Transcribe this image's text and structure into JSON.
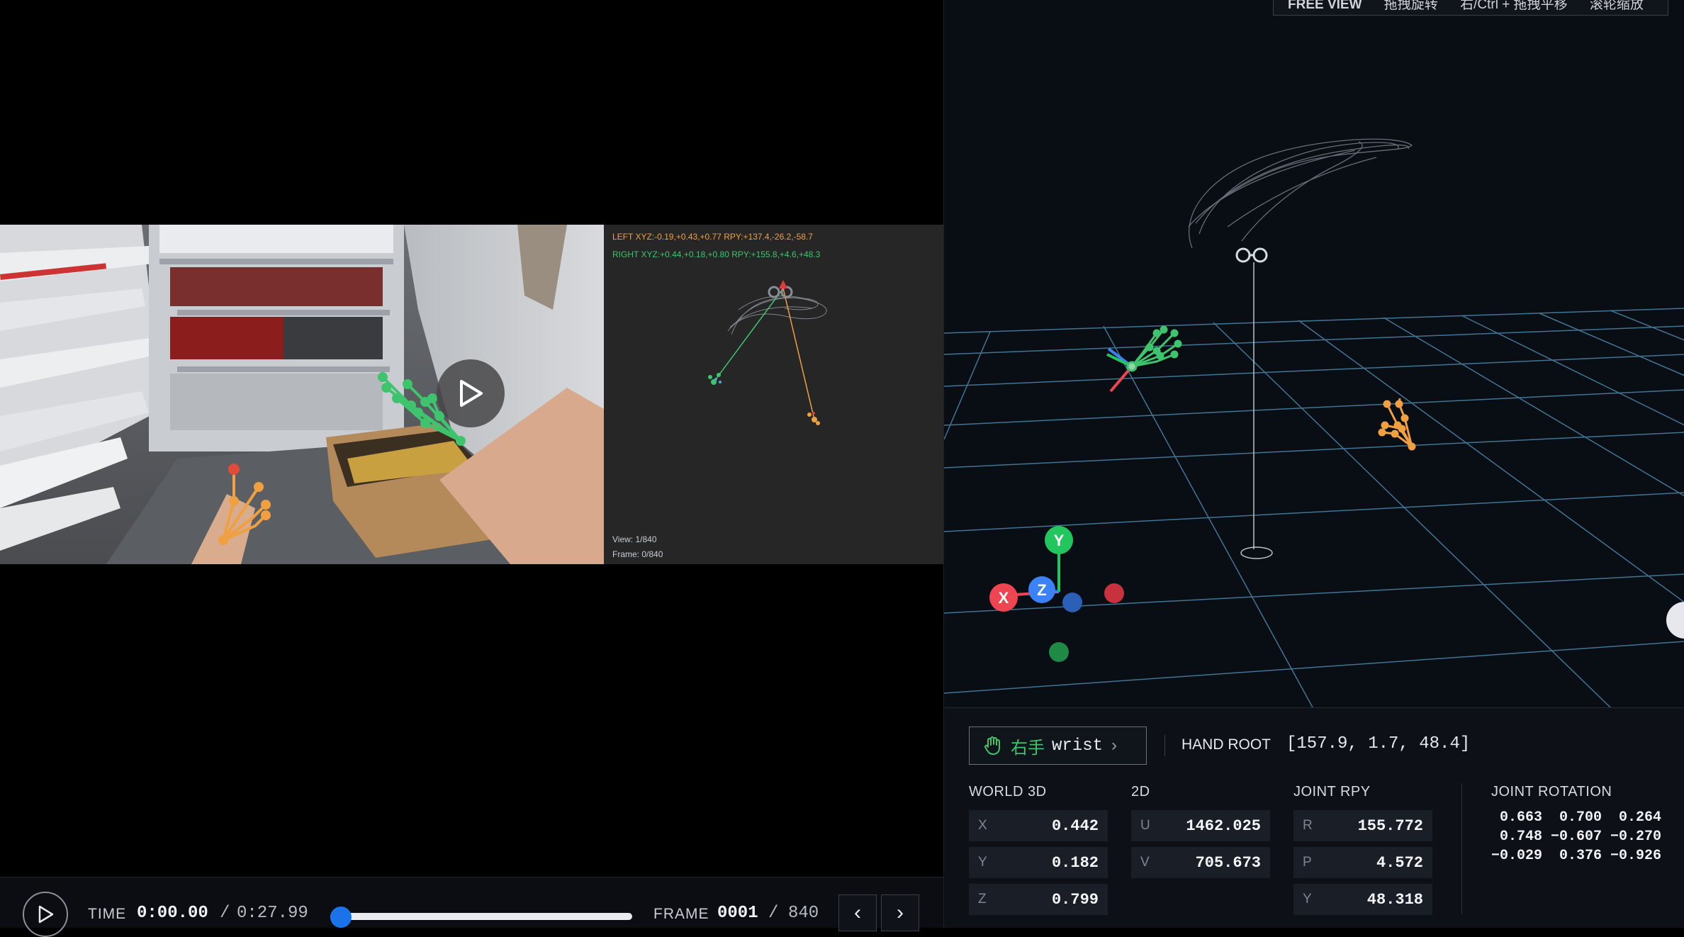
{
  "video": {
    "left_hand_readout": "LEFT XYZ:-0.19,+0.43,+0.77 RPY:+137.4,-26.2,-58.7",
    "right_hand_readout": "RIGHT XYZ:+0.44,+0.18,+0.80 RPY:+155.8,+4.6,+48.3",
    "view_info": "View: 1/840",
    "frame_info": "Frame: 0/840"
  },
  "playback": {
    "time_label": "TIME",
    "time_current": "0:00.00",
    "time_separator": "/",
    "time_total": "0:27.99",
    "progress": 0.0,
    "frame_label": "FRAME",
    "frame_current": "0001",
    "frame_separator": "/",
    "frame_total": "840",
    "prev_icon": "‹",
    "next_icon": "›"
  },
  "scene": {
    "view_hint": [
      "FREE VIEW",
      "拖拽旋转",
      "右/Ctrl + 拖拽平移",
      "滚轮缩放"
    ],
    "axis_labels": {
      "x": "X",
      "y": "Y",
      "z": "Z"
    }
  },
  "info": {
    "hand_label": "右手",
    "joint_label": "wrist",
    "hand_root_label": "HAND ROOT",
    "hand_root_value": "[157.9, 1.7, 48.4]",
    "world3d": {
      "label": "WORLD 3D",
      "rows": [
        {
          "k": "X",
          "v": "0.442"
        },
        {
          "k": "Y",
          "v": "0.182"
        },
        {
          "k": "Z",
          "v": "0.799"
        }
      ]
    },
    "image2d": {
      "label": "2D",
      "rows": [
        {
          "k": "U",
          "v": "1462.025"
        },
        {
          "k": "V",
          "v": "705.673"
        }
      ]
    },
    "joint_rpy": {
      "label": "JOINT RPY",
      "rows": [
        {
          "k": "R",
          "v": "155.772"
        },
        {
          "k": "P",
          "v": "4.572"
        },
        {
          "k": "Y",
          "v": "48.318"
        }
      ]
    },
    "joint_rotation": {
      "label": "JOINT ROTATION",
      "rows": [
        " 0.663  0.700  0.264",
        " 0.748 −0.607 −0.270",
        "−0.029  0.376 −0.926"
      ]
    }
  },
  "colors": {
    "accent": "#1a73e8",
    "right_hand": "#3ec46d",
    "left_hand": "#f0a040",
    "grid": "#4f8fb5",
    "x_axis": "#ef4451",
    "y_axis": "#22c55e",
    "z_axis": "#3b82f6"
  }
}
